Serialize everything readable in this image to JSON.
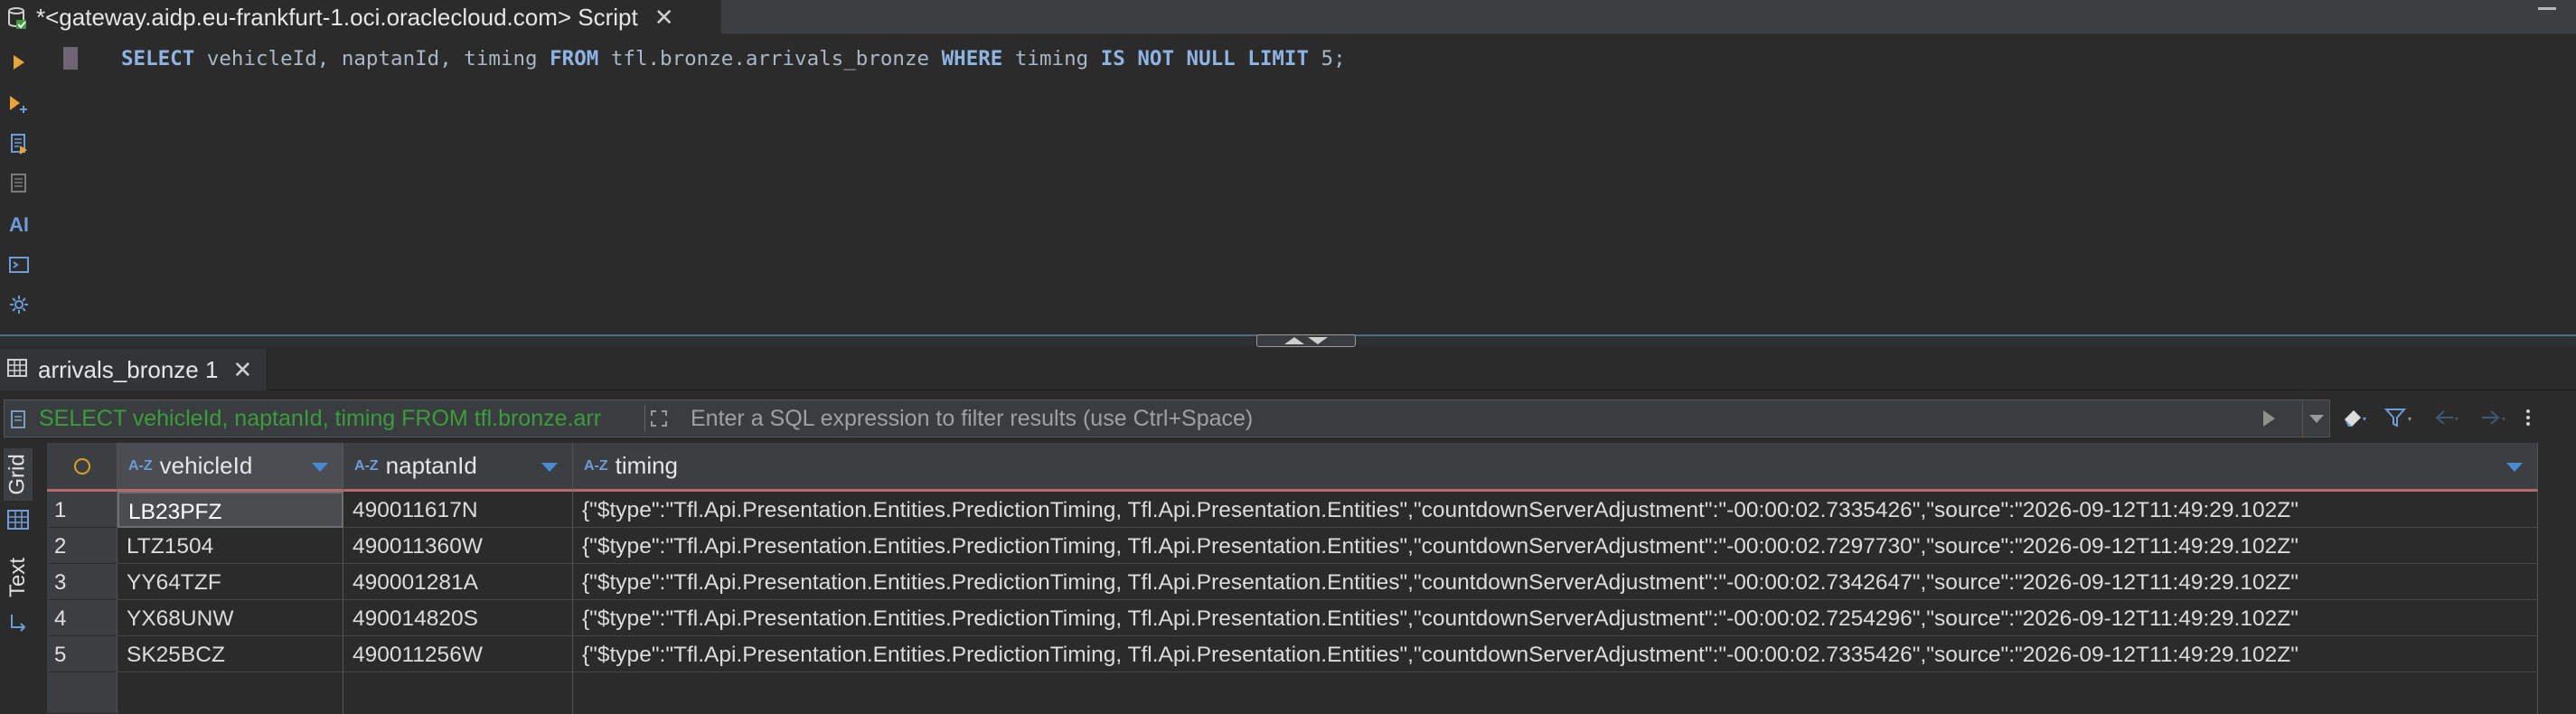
{
  "editor_tab": {
    "title": "*<gateway.aidp.eu-frankfurt-1.oci.oraclecloud.com> Script",
    "close": "✕"
  },
  "toolbar": {
    "ai_label": "AI"
  },
  "sql": {
    "tokens": [
      {
        "t": "SELECT",
        "k": true
      },
      {
        "t": " vehicleId, naptanId, timing ",
        "k": false
      },
      {
        "t": "FROM",
        "k": true
      },
      {
        "t": " tfl.bronze.arrivals_bronze ",
        "k": false
      },
      {
        "t": "WHERE",
        "k": true
      },
      {
        "t": " timing ",
        "k": false
      },
      {
        "t": "IS NOT NULL LIMIT",
        "k": true
      },
      {
        "t": " 5;",
        "k": false
      }
    ]
  },
  "results_tab": {
    "label": "arrivals_bronze 1",
    "close": "✕"
  },
  "filter": {
    "query": "SELECT vehicleId, naptanId, timing FROM tfl.bronze.arr",
    "placeholder": "Enter a SQL expression to filter results (use Ctrl+Space)"
  },
  "side_tabs": {
    "grid": "Grid",
    "text": "Text"
  },
  "grid": {
    "columns": [
      {
        "type": "A-Z",
        "name": "vehicleId"
      },
      {
        "type": "A-Z",
        "name": "naptanId"
      },
      {
        "type": "A-Z",
        "name": "timing"
      }
    ],
    "rows": [
      {
        "n": "1",
        "vehicleId": "LB23PFZ",
        "naptanId": "490011617N",
        "timing": "{\"$type\":\"Tfl.Api.Presentation.Entities.PredictionTiming, Tfl.Api.Presentation.Entities\",\"countdownServerAdjustment\":\"-00:00:02.7335426\",\"source\":\"2026-09-12T11:49:29.102Z\""
      },
      {
        "n": "2",
        "vehicleId": "LTZ1504",
        "naptanId": "490011360W",
        "timing": "{\"$type\":\"Tfl.Api.Presentation.Entities.PredictionTiming, Tfl.Api.Presentation.Entities\",\"countdownServerAdjustment\":\"-00:00:02.7297730\",\"source\":\"2026-09-12T11:49:29.102Z\""
      },
      {
        "n": "3",
        "vehicleId": "YY64TZF",
        "naptanId": "490001281A",
        "timing": "{\"$type\":\"Tfl.Api.Presentation.Entities.PredictionTiming, Tfl.Api.Presentation.Entities\",\"countdownServerAdjustment\":\"-00:00:02.7342647\",\"source\":\"2026-09-12T11:49:29.102Z\""
      },
      {
        "n": "4",
        "vehicleId": "YX68UNW",
        "naptanId": "490014820S",
        "timing": "{\"$type\":\"Tfl.Api.Presentation.Entities.PredictionTiming, Tfl.Api.Presentation.Entities\",\"countdownServerAdjustment\":\"-00:00:02.7254296\",\"source\":\"2026-09-12T11:49:29.102Z\""
      },
      {
        "n": "5",
        "vehicleId": "SK25BCZ",
        "naptanId": "490011256W",
        "timing": "{\"$type\":\"Tfl.Api.Presentation.Entities.PredictionTiming, Tfl.Api.Presentation.Entities\",\"countdownServerAdjustment\":\"-00:00:02.7335426\",\"source\":\"2026-09-12T11:49:29.102Z\""
      }
    ]
  },
  "colors": {
    "accent": "#4a8ad4",
    "keyword": "#8fb4e3",
    "filter_query": "#3c9c3c",
    "header_underline": "#b86a6a"
  }
}
